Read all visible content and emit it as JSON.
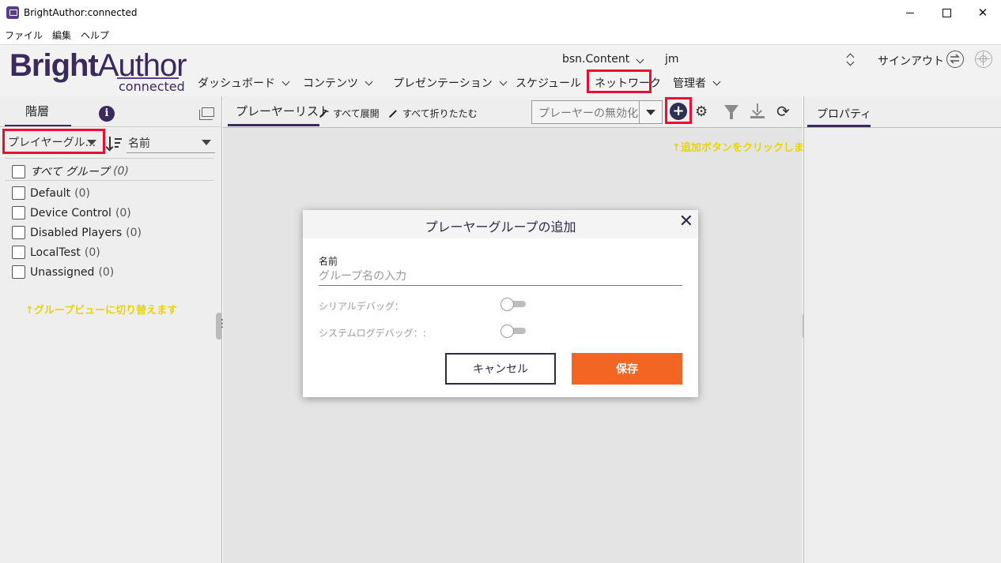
{
  "window": {
    "title": "BrightAuthor:connected"
  },
  "menu": [
    "ファイル",
    "編集",
    "ヘルプ"
  ],
  "logo": {
    "bright": "Bright",
    "author": "Author",
    "sub": "connected"
  },
  "header": {
    "account": "bsn.Content",
    "user": "jm",
    "sign_out": "サインアウト",
    "nav": [
      "ダッシュボード",
      "コンテンツ",
      "プレゼンテーション",
      "スケジュール",
      "ネットワーク",
      "管理者"
    ]
  },
  "left_panel": {
    "tab": "階層",
    "group_select": "プレイヤーグル...",
    "sort_select": "名前",
    "all_groups": {
      "label": "すべて グループ",
      "count": "(0)"
    },
    "groups": [
      {
        "label": "Default",
        "count": "(0)"
      },
      {
        "label": "Device Control",
        "count": "(0)"
      },
      {
        "label": "Disabled Players",
        "count": "(0)"
      },
      {
        "label": "LocalTest",
        "count": "(0)"
      },
      {
        "label": "Unassigned",
        "count": "(0)"
      }
    ],
    "annotation": "↑グループビューに切り替えます"
  },
  "middle_panel": {
    "tab": "プレーヤーリスト",
    "expand_all": "すべて展開",
    "collapse_all": "すべて折りたたむ",
    "disable_select": "プレーヤーの無効化",
    "annotation": "↑追加ボタンをクリックします"
  },
  "right_panel": {
    "tab": "プロパティ"
  },
  "modal": {
    "title": "プレーヤーグループの追加",
    "name_label": "名前",
    "name_placeholder": "グループ名の入力",
    "serial_debug_label": "シリアルデバッグ：",
    "serial_debug_on": false,
    "syslog_debug_label": "システムログデバッグ：:",
    "syslog_debug_on": false,
    "cancel": "キャンセル",
    "save": "保存"
  },
  "colors": {
    "brand": "#3b2a5e",
    "accent": "#f26522",
    "highlight": "#e8112d",
    "annotation": "#e8d400"
  }
}
